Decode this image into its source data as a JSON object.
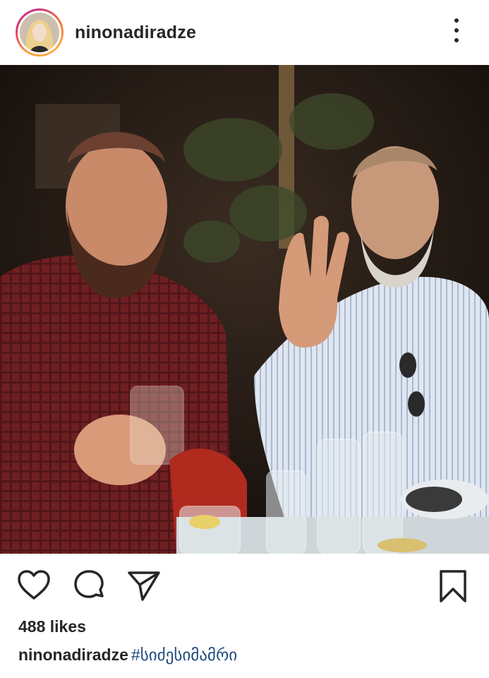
{
  "post": {
    "username": "ninonadiradze",
    "likes_text": "488 likes",
    "caption": {
      "username": "ninonadiradze",
      "hashtag": "#სიძესიმამრი"
    }
  },
  "icons": {
    "avatar": "profile-photo",
    "more": "more-options-icon",
    "like": "heart-icon",
    "comment": "comment-icon",
    "share": "paper-plane-icon",
    "save": "bookmark-icon"
  },
  "colors": {
    "text": "#262626",
    "hashtag": "#1e4a7e",
    "story_ring": "#e1306c"
  }
}
